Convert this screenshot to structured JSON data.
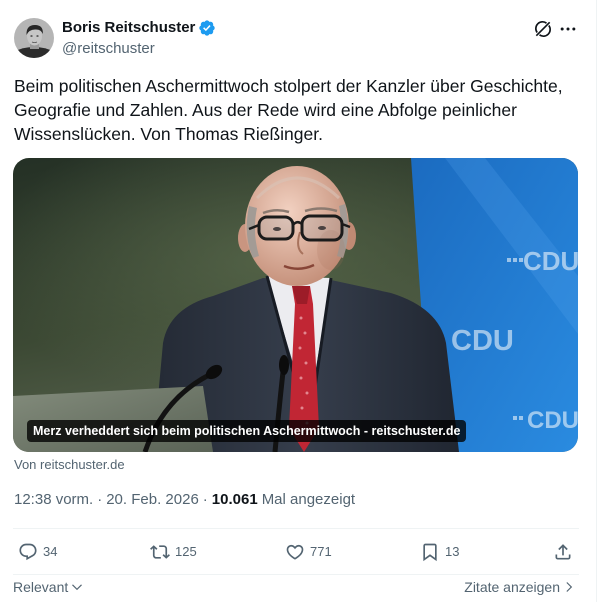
{
  "author": {
    "name": "Boris Reitschuster",
    "handle": "@reitschuster",
    "verified_icon": "verified-badge-icon"
  },
  "header_actions": {
    "grok_icon": "grok-icon",
    "more_icon": "more-icon"
  },
  "tweet": {
    "text": "Beim politischen Aschermittwoch stolpert der Kanzler über Geschichte, Geografie und Zahlen. Aus der Rede wird eine Abfolge peinlicher Wissenslücken. Von Thomas Rießinger."
  },
  "card": {
    "caption": "Merz verheddert sich beim politischen Aschermittwoch - reitschuster.de",
    "source": "Von reitschuster.de",
    "backdrop_logo_text": "CDU"
  },
  "meta": {
    "time": "12:38 vorm.",
    "separator": "·",
    "date": "20. Feb. 2026",
    "views_count": "10.061",
    "views_label": "Mal angezeigt"
  },
  "actions": {
    "reply": {
      "icon": "reply-icon",
      "count": "34"
    },
    "repost": {
      "icon": "repost-icon",
      "count": "125"
    },
    "like": {
      "icon": "heart-icon",
      "count": "771"
    },
    "bookmark": {
      "icon": "bookmark-icon",
      "count": "13"
    },
    "share": {
      "icon": "share-icon"
    }
  },
  "replies_bar": {
    "sort_label": "Relevant",
    "quotes_label": "Zitate anzeigen"
  },
  "colors": {
    "text_primary": "#0f1419",
    "text_secondary": "#536471",
    "brand_blue": "#1d9bf0",
    "divider": "#eff3f4"
  }
}
